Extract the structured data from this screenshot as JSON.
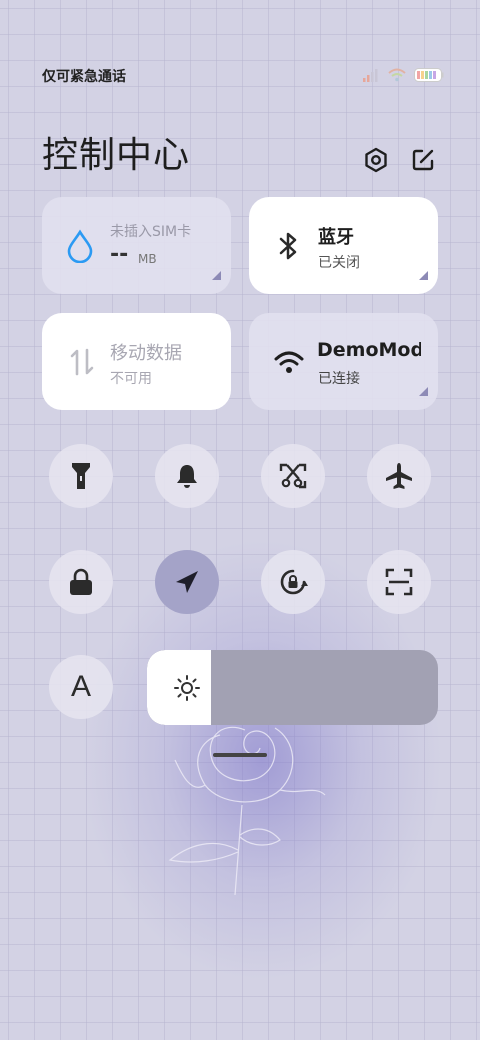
{
  "status_bar": {
    "carrier_text": "仅可紧急通话",
    "icons": [
      "signal-icon",
      "wifi-icon",
      "battery-icon"
    ]
  },
  "header": {
    "title": "控制中心",
    "settings_icon": "settings-icon",
    "edit_icon": "edit-icon"
  },
  "cards": {
    "data_usage": {
      "label": "未插入SIM卡",
      "value": "--",
      "unit": "MB",
      "icon": "water-drop-icon"
    },
    "bluetooth": {
      "title": "蓝牙",
      "subtitle": "已关闭",
      "icon": "bluetooth-icon"
    },
    "mobile_data": {
      "title": "移动数据",
      "subtitle": "不可用",
      "icon": "data-arrows-icon"
    },
    "wifi": {
      "title": "DemoMod",
      "subtitle": "已连接",
      "icon": "wifi-icon"
    }
  },
  "toggles": [
    {
      "icon": "flashlight-icon",
      "active": false
    },
    {
      "icon": "bell-icon",
      "active": false
    },
    {
      "icon": "screenshot-icon",
      "active": false
    },
    {
      "icon": "airplane-icon",
      "active": false
    },
    {
      "icon": "lock-icon",
      "active": false
    },
    {
      "icon": "location-icon",
      "active": true
    },
    {
      "icon": "rotation-lock-icon",
      "active": false
    },
    {
      "icon": "scan-icon",
      "active": false
    }
  ],
  "font_size_button": {
    "label": "A"
  },
  "brightness": {
    "icon": "sun-icon",
    "level_fraction": 0.22
  },
  "colors": {
    "accent": "#2b9af3",
    "active_toggle": "#a4a3c8",
    "slider_track": "#a2a1b3"
  }
}
